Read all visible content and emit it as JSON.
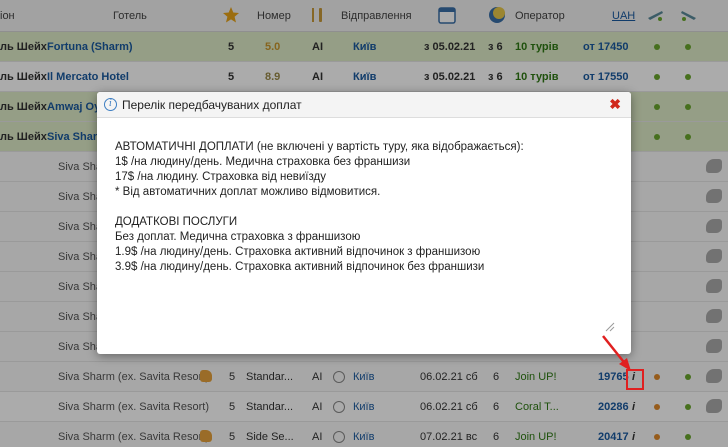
{
  "header": {
    "region": "іон",
    "hotel": "Готель",
    "room": "Номер",
    "departure": "Відправлення",
    "operator": "Оператор",
    "currency": "UAH",
    "icons": [
      "star-icon",
      "fork-knife-icon",
      "calendar-icon",
      "moon-icon",
      "plane-depart-icon",
      "plane-return-icon"
    ]
  },
  "rows": [
    {
      "region": "ль Шейх",
      "hotel": "Fortuna (Sharm)",
      "stars": "5",
      "rating": "5.0",
      "meal": "AI",
      "city": "Київ",
      "date": "з 05.02.21",
      "nights": "з 6",
      "tours": "10 турів",
      "price": "от 17450"
    },
    {
      "region": "ль Шейх",
      "hotel": "Il Mercato Hotel",
      "stars": "5",
      "rating": "8.9",
      "meal": "AI",
      "city": "Київ",
      "date": "з 05.02.21",
      "nights": "з 6",
      "tours": "10 турів",
      "price": "от 17550"
    },
    {
      "region": "ль Шейх",
      "hotel": "Amwaj Oy"
    },
    {
      "region": "ль Шейх",
      "hotel": "Siva Shar"
    },
    {
      "hotel": "Siva Shar"
    },
    {
      "hotel": "Siva Shar"
    },
    {
      "hotel": "Siva Shar"
    },
    {
      "hotel": "Siva Shar"
    },
    {
      "hotel": "Siva Shar"
    },
    {
      "hotel": "Siva Shar"
    },
    {
      "hotel": "Siva Shar"
    },
    {
      "hotel": "Siva Sharm (ex. Savita Resort)",
      "stars": "5",
      "room": "Standar...",
      "meal": "AI",
      "city": "Київ",
      "date": "06.02.21 сб",
      "nights": "6",
      "operator": "Join UP!",
      "price": "19765",
      "info": "i"
    },
    {
      "hotel": "Siva Sharm (ex. Savita Resort)",
      "stars": "5",
      "room": "Standar...",
      "meal": "AI",
      "city": "Київ",
      "date": "06.02.21 сб",
      "nights": "6",
      "operator": "Coral T...",
      "price": "20286",
      "info": "i"
    },
    {
      "hotel": "Siva Sharm (ex. Savita Resort)",
      "stars": "5",
      "room": "Side Se...",
      "meal": "AI",
      "city": "Київ",
      "date": "07.02.21 вс",
      "nights": "6",
      "operator": "Join UP!",
      "price": "20417",
      "info": "i"
    }
  ],
  "dialog": {
    "title": "Перелік передбачуваних доплат",
    "close": "✖",
    "lines": [
      "АВТОМАТИЧНІ ДОПЛАТИ (не включені у вартість туру, яка відображається):",
      "1$ /на людину/день. Медична страховка без франшизи",
      "17$ /на людину. Страховка від невиїзду",
      "* Від автоматичних доплат можливо відмовитися.",
      "",
      "ДОДАТКОВІ ПОСЛУГИ",
      "Без доплат. Медична страховка з франшизою",
      "1.9$ /на людину/день. Страховка активний відпочинок з франшизою",
      "3.9$ /на людину/день. Страховка активний відпочинок без франшизи"
    ]
  },
  "colors": {
    "accent_green": "#2f7a14",
    "link_blue": "#1a5aa0",
    "close_red": "#d0281c",
    "highlight_red": "#e02020"
  }
}
